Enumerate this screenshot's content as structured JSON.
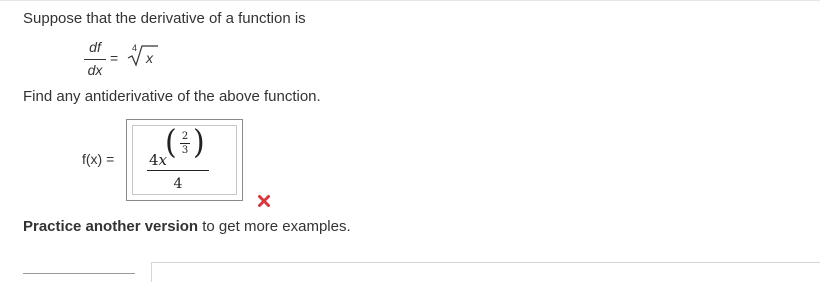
{
  "question": {
    "prompt": "Suppose that the derivative of a function is",
    "derivative": {
      "numerator": "df",
      "denominator": "dx",
      "equals": "=",
      "radical_index": "4",
      "radical_argument": "x"
    },
    "instruction": "Find any antiderivative of the above function."
  },
  "answer": {
    "label": "f(x)",
    "equals": "=",
    "coefficient": "4",
    "variable": "x",
    "exponent_numerator": "2",
    "exponent_denominator": "3",
    "denominator": "4",
    "status": "incorrect",
    "status_color": "#d9363e"
  },
  "footer": {
    "practice_link": "Practice another version",
    "practice_suffix": " to get more examples."
  }
}
